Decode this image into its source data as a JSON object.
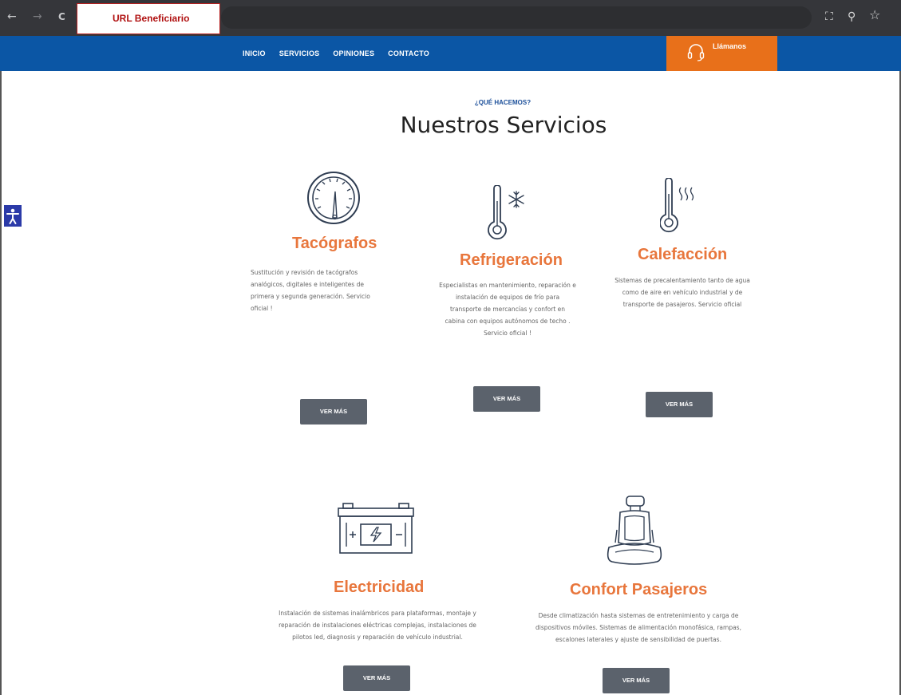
{
  "browser": {
    "back_icon": "arrow-left-icon",
    "forward_icon": "arrow-right-icon",
    "reload_icon": "reload-icon",
    "url_label": "URL Beneficiario",
    "translate_icon": "translate-icon",
    "zoom_icon": "zoom-icon",
    "bookmark_icon": "star-icon",
    "back_glyph": "←",
    "forward_glyph": "→",
    "reload_glyph": "C",
    "translate_glyph": "⛶",
    "zoom_glyph": "⚲",
    "star_glyph": "☆"
  },
  "nav": {
    "items": [
      "INICIO",
      "SERVICIOS",
      "OPINIONES",
      "CONTACTO"
    ],
    "call_label": "Llámanos",
    "call_icon": "headset-icon"
  },
  "colors": {
    "nav_bg": "#0b56a5",
    "call_bg": "#e8701a",
    "service_title": "#e8763c",
    "button_bg": "#5b626c"
  },
  "header": {
    "eyebrow": "¿QUÉ HACEMOS?",
    "title": "Nuestros Servicios"
  },
  "services": [
    {
      "icon": "tachometer-icon",
      "title": "Tacógrafos",
      "lines": [
        "Sustitución y revisión de tacógrafos",
        "analógicos, digitales e inteligentes de",
        "primera y segunda generación. Servicio",
        "oficial !"
      ],
      "button": "VER MÁS"
    },
    {
      "icon": "thermometer-snowflake-icon",
      "title": "Refrigeración",
      "lines": [
        "Especialistas en mantenimiento, reparación e",
        "instalación de equipos de frío para",
        "transporte de mercancías y confort en",
        "cabina con equipos autónomos de techo .",
        "Servicio oficial !"
      ],
      "button": "VER MÁS"
    },
    {
      "icon": "thermometer-heat-icon",
      "title": "Calefacción",
      "lines": [
        "Sistemas de precalentamiento tanto de agua",
        "como de aire en vehículo industrial y de",
        "transporte de pasajeros. Servicio oficial"
      ],
      "button": "VER MÁS"
    },
    {
      "icon": "battery-icon",
      "title": "Electricidad",
      "lines": [
        "Instalación de sistemas inalámbricos para plataformas, montaje y",
        "reparación de instalaciones eléctricas complejas, instalaciones de",
        "pilotos led, diagnosis y reparación de vehículo industrial."
      ],
      "button": "VER MÁS"
    },
    {
      "icon": "seat-icon",
      "title": "Confort Pasajeros",
      "lines": [
        "Desde climatización hasta sistemas de entretenimiento y carga de",
        "dispositivos móviles. Sistemas de alimentación monofásica, rampas,",
        "escalones laterales y ajuste de sensibilidad de puertas."
      ],
      "button": "VER MÁS"
    }
  ],
  "accessibility_icon": "accessibility-icon"
}
